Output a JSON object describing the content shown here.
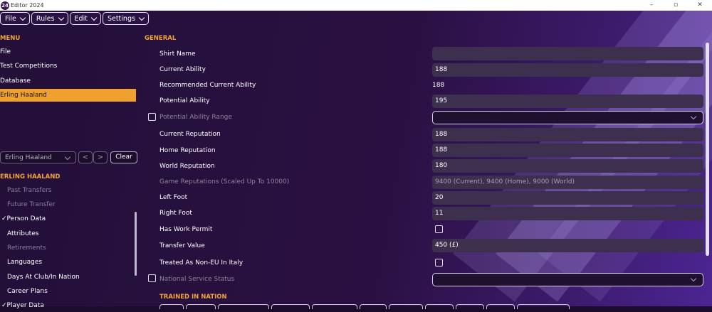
{
  "window": {
    "title": "Editor 2024",
    "controls": [
      "–",
      "▫",
      "✕"
    ]
  },
  "menubar": [
    {
      "label": "File"
    },
    {
      "label": "Rules"
    },
    {
      "label": "Edit"
    },
    {
      "label": "Settings"
    }
  ],
  "sidebar": {
    "menu_heading": "MENU",
    "menu_items": [
      "File",
      "Test Competitions",
      "Database",
      "Erling Haaland"
    ],
    "player_select": "Erling Haaland",
    "prev_label": "<",
    "next_label": ">",
    "clear_label": "Clear",
    "player_heading": "ERLING HAALAND",
    "tree": {
      "past_transfers": "Past Transfers",
      "future_transfer": "Future Transfer",
      "person_data": "Person Data",
      "attributes": "Attributes",
      "retirements": "Retirements",
      "languages": "Languages",
      "days_at_club": "Days At Club/In Nation",
      "career_plans": "Career Plans",
      "player_data": "Player Data"
    }
  },
  "general": {
    "heading": "GENERAL",
    "shirt_name": {
      "label": "Shirt Name",
      "value": ""
    },
    "current_ability": {
      "label": "Current Ability",
      "value": "188"
    },
    "recommended_ca": {
      "label": "Recommended Current Ability",
      "value": "188"
    },
    "potential_ability": {
      "label": "Potential Ability",
      "value": "195"
    },
    "pa_range": {
      "label": "Potential Ability Range",
      "value": ""
    },
    "current_reputation": {
      "label": "Current Reputation",
      "value": "188"
    },
    "home_reputation": {
      "label": "Home Reputation",
      "value": "188"
    },
    "world_reputation": {
      "label": "World Reputation",
      "value": "180"
    },
    "game_reputations": {
      "label": "Game Reputations (Scaled Up To 10000)",
      "value": "9400 (Current), 9400 (Home), 9000 (World)"
    },
    "left_foot": {
      "label": "Left Foot",
      "value": "20"
    },
    "right_foot": {
      "label": "Right Foot",
      "value": "11"
    },
    "work_permit": {
      "label": "Has Work Permit",
      "checked": false
    },
    "transfer_value": {
      "label": "Transfer Value",
      "value": "450 (£)"
    },
    "non_eu_italy": {
      "label": "Treated As Non-EU In Italy",
      "checked": false
    },
    "national_service": {
      "label": "National Service Status",
      "value": ""
    }
  },
  "trained_heading": "TRAINED IN NATION",
  "colors": {
    "accent": "#f0a02c",
    "field_bg": "#3d2f4e",
    "background": "#230f38"
  }
}
